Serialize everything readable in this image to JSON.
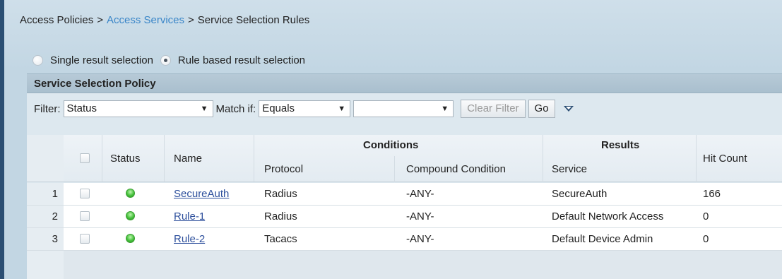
{
  "breadcrumb": {
    "items": [
      "Access Policies",
      "Access Services",
      "Service Selection Rules"
    ],
    "separator": ">"
  },
  "selection_mode": {
    "options": [
      "Single result selection",
      "Rule based result selection"
    ],
    "selected": "Rule based result selection"
  },
  "panel": {
    "title": "Service Selection Policy"
  },
  "filter_bar": {
    "filter_label": "Filter:",
    "filter_value": "Status",
    "match_if_label": "Match if:",
    "match_value": "Equals",
    "value_select": "",
    "clear_filter_label": "Clear Filter",
    "go_label": "Go"
  },
  "table": {
    "headers": {
      "status": "Status",
      "name": "Name",
      "conditions": "Conditions",
      "protocol": "Protocol",
      "compound_condition": "Compound Condition",
      "results": "Results",
      "service": "Service",
      "hit_count": "Hit Count"
    },
    "rows": [
      {
        "num": "1",
        "name": "SecureAuth",
        "protocol": "Radius",
        "compound": "-ANY-",
        "service": "SecureAuth",
        "hits": "166"
      },
      {
        "num": "2",
        "name": "Rule-1",
        "protocol": "Radius",
        "compound": "-ANY-",
        "service": "Default Network Access",
        "hits": "0"
      },
      {
        "num": "3",
        "name": "Rule-2",
        "protocol": "Tacacs",
        "compound": "-ANY-",
        "service": "Default Device Admin",
        "hits": "0"
      }
    ]
  },
  "colors": {
    "link": "#3a86c8",
    "status_enabled": "#46c23c",
    "panel_header": "#b7cad7"
  }
}
